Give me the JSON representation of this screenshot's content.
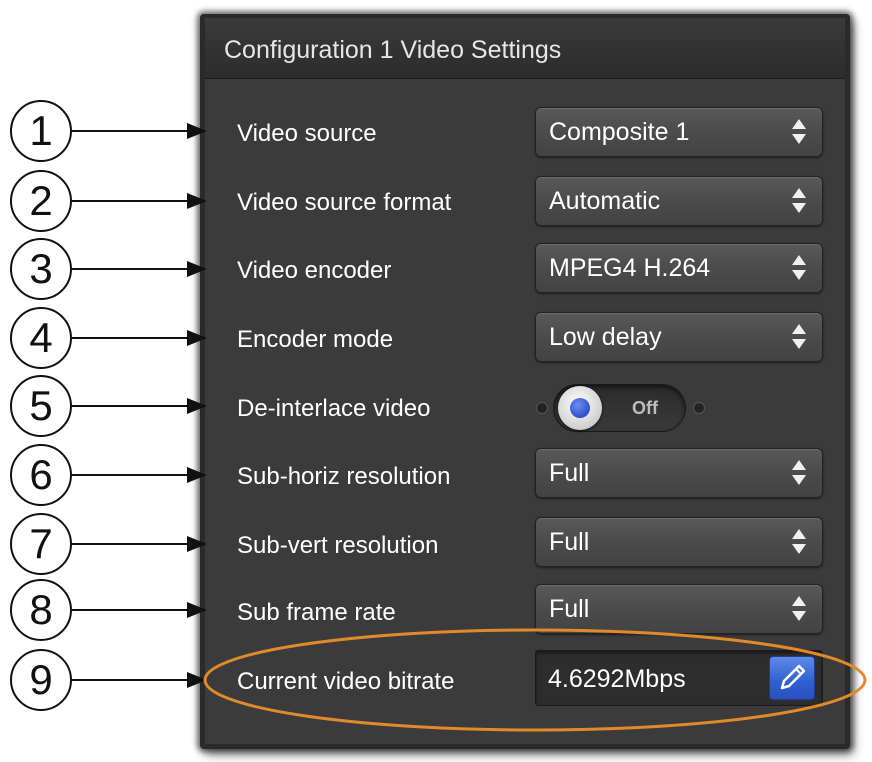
{
  "panel": {
    "title": "Configuration 1 Video Settings"
  },
  "settings": [
    {
      "callout": "1",
      "label": "Video source",
      "control": "select",
      "value": "Composite 1"
    },
    {
      "callout": "2",
      "label": "Video source format",
      "control": "select",
      "value": "Automatic"
    },
    {
      "callout": "3",
      "label": "Video encoder",
      "control": "select",
      "value": "MPEG4 H.264"
    },
    {
      "callout": "4",
      "label": "Encoder mode",
      "control": "select",
      "value": "Low delay"
    },
    {
      "callout": "5",
      "label": "De-interlace video",
      "control": "toggle",
      "value": "Off"
    },
    {
      "callout": "6",
      "label": "Sub-horiz resolution",
      "control": "select",
      "value": "Full"
    },
    {
      "callout": "7",
      "label": "Sub-vert resolution",
      "control": "select",
      "value": "Full"
    },
    {
      "callout": "8",
      "label": "Sub frame rate",
      "control": "select",
      "value": "Full"
    },
    {
      "callout": "9",
      "label": "Current video bitrate",
      "control": "readout",
      "value": "4.6292Mbps"
    }
  ],
  "icons": {
    "select_arrows": "up-down-arrows-icon",
    "edit": "pencil-icon",
    "toggle_knob": "radio-knob-icon"
  },
  "colors": {
    "panel_background": "#3b3b3b",
    "highlight_ellipse": "#e08a2a",
    "edit_button": "#2f5fd0",
    "toggle_knob_center": "#2d50c8"
  }
}
